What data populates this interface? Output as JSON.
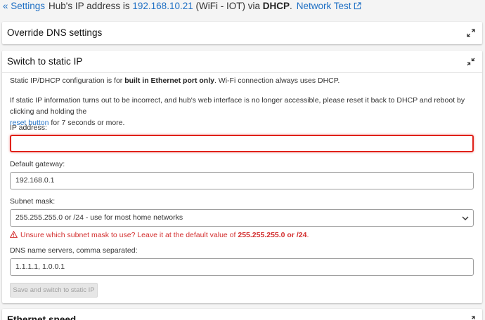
{
  "topbar": {
    "back_link": "« Settings",
    "ip_prefix": "Hub's IP address is ",
    "ip_address": "192.168.10.21",
    "ip_middle": " (WiFi - IOT) via ",
    "ip_mode": "DHCP",
    "ip_suffix": ".",
    "network_test_link": "Network Test",
    "network_test_icon": "external-link-icon"
  },
  "cards": {
    "override_dns": {
      "title": "Override DNS settings",
      "icon": "expand-icon"
    },
    "static_ip": {
      "title": "Switch to static IP",
      "icon": "collapse-icon",
      "intro": {
        "prefix": "Static IP/DHCP configuration is for ",
        "bold": "built in Ethernet port only",
        "suffix": ". Wi-Fi connection always uses DHCP."
      },
      "notice": {
        "line1": "If static IP information turns out to be incorrect, and hub's web interface is no longer accessible, please reset it back to DHCP and reboot by clicking and holding the",
        "link": "reset button",
        "line2_suffix": " for 7 seconds or more."
      },
      "ip_label": "IP address:",
      "ip_value": "",
      "gateway_label": "Default gateway:",
      "gateway_value": "192.168.0.1",
      "subnet_label": "Subnet mask:",
      "subnet_value": "255.255.255.0 or /24 - use for most home networks",
      "warning": {
        "icon": "warning-icon",
        "prefix": "Unsure which subnet mask to use? Leave it at the default value of ",
        "bold": "255.255.255.0 or /24",
        "suffix": "."
      },
      "dns_label": "DNS name servers, comma separated:",
      "dns_value": "1.1.1.1, 1.0.0.1",
      "save_button": "Save and switch to static IP"
    },
    "ethernet_speed": {
      "title": "Ethernet speed",
      "icon": "expand-icon"
    }
  },
  "colors": {
    "link": "#1e6fc4",
    "error": "#e0221a",
    "warning_text": "#d32f2f"
  }
}
